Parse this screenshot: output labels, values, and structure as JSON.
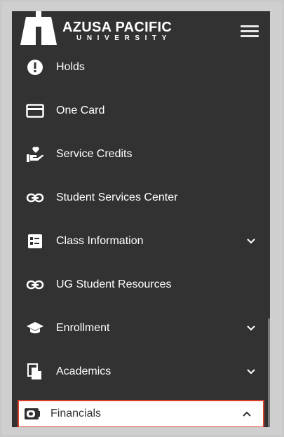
{
  "header": {
    "logo_main": "AZUSA PACIFIC",
    "logo_sub": "UNIVERSITY",
    "menu_icon": "hamburger-icon"
  },
  "menu": {
    "items": [
      {
        "label": "Holds",
        "icon": "exclamation-icon",
        "expandable": false
      },
      {
        "label": "One Card",
        "icon": "credit-card-icon",
        "expandable": false
      },
      {
        "label": "Service Credits",
        "icon": "volunteer-hand-heart-icon",
        "expandable": false
      },
      {
        "label": "Student Services Center",
        "icon": "link-icon",
        "expandable": false
      },
      {
        "label": "Class Information",
        "icon": "list-icon",
        "expandable": true
      },
      {
        "label": "UG Student Resources",
        "icon": "link-icon",
        "expandable": false
      },
      {
        "label": "Enrollment",
        "icon": "graduation-cap-icon",
        "expandable": true
      },
      {
        "label": "Academics",
        "icon": "documents-icon",
        "expandable": true
      }
    ],
    "active_item": {
      "label": "Financials",
      "icon": "wallet-icon",
      "expanded": true
    }
  },
  "colors": {
    "sidebar_bg": "#323232",
    "highlight_border": "#d9412b",
    "active_bg": "#ffffff"
  }
}
